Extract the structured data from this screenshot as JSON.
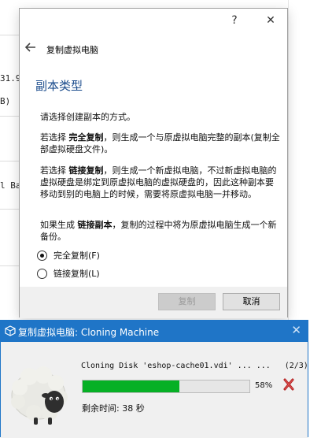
{
  "background": {
    "fragments": [
      "31.9",
      "B)",
      "l Ba"
    ]
  },
  "clone_dialog": {
    "titlebar": {
      "help_label": "?",
      "close_label": "✕"
    },
    "header_title": "复制虚拟电脑",
    "back_icon": "arrow-left-icon",
    "heading": "副本类型",
    "intro": "请选择创建副本的方式。",
    "full_clone_para": {
      "prefix": "若选择 ",
      "term": "完全复制",
      "suffix": "，则生成一个与原虚拟电脑完整的副本(复制全部虚拟硬盘文件)。"
    },
    "linked_clone_para": {
      "prefix": "若选择 ",
      "term": "链接复制",
      "suffix": "，则生成一个新虚拟电脑，不过新虚拟电脑的虚拟硬盘是绑定到原虚拟电脑的虚拟硬盘的，因此这种副本要移动到别的电脑上的时候，需要将原虚拟电脑一并移动。"
    },
    "snapshot_para": {
      "prefix": "如果生成 ",
      "term": "链接副本",
      "suffix": "，复制的过程中将为原虚拟电脑生成一个新备份。"
    },
    "options": [
      {
        "label": "完全复制(F)",
        "checked": true
      },
      {
        "label": "链接复制(L)",
        "checked": false
      }
    ],
    "buttons": {
      "clone": "复制",
      "cancel": "取消"
    }
  },
  "progress_dialog": {
    "title": "复制虚拟电脑: Cloning Machine",
    "close_label": "✕",
    "operation": "Cloning Disk 'eshop-cache01.vdi' ... ...",
    "operation_count": "(2/3)",
    "progress_value": 0.58,
    "progress_label": "58%",
    "remaining": "剩余时间:  38 秒",
    "colors": {
      "titlebar": "#1f75c7",
      "progress": "#06b025",
      "cancel_icon": "#b22222"
    }
  }
}
